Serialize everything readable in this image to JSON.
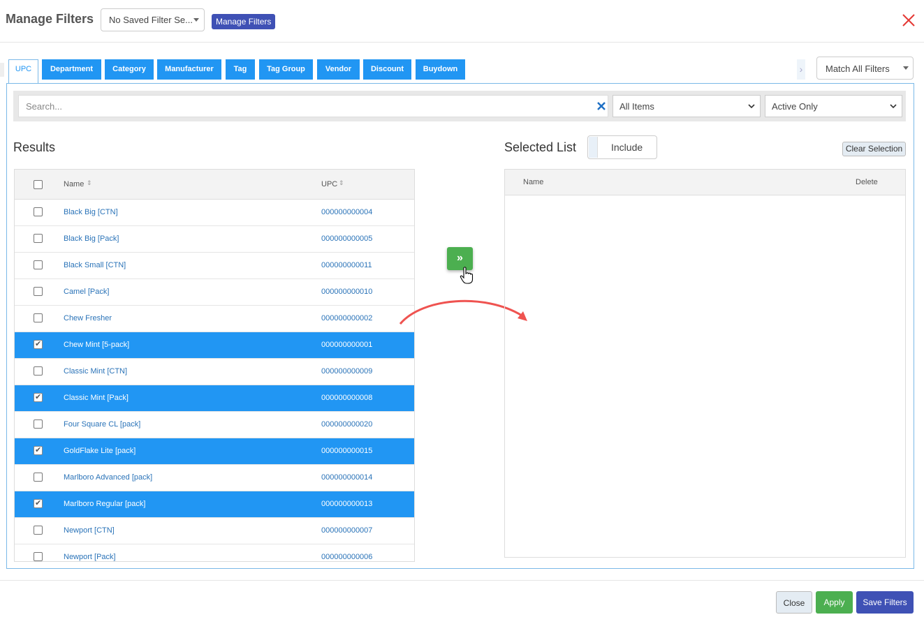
{
  "header": {
    "title": "Manage Filters",
    "saved_filter_select": "No Saved Filter Se...",
    "manage_filters_button": "Manage Filters"
  },
  "tabs": [
    {
      "label": "UPC",
      "active": true
    },
    {
      "label": "Department",
      "active": false
    },
    {
      "label": "Category",
      "active": false
    },
    {
      "label": "Manufacturer",
      "active": false
    },
    {
      "label": "Tag",
      "active": false
    },
    {
      "label": "Tag Group",
      "active": false
    },
    {
      "label": "Vendor",
      "active": false
    },
    {
      "label": "Discount",
      "active": false
    },
    {
      "label": "Buydown",
      "active": false
    }
  ],
  "match_select": "Match All Filters",
  "search": {
    "placeholder": "Search...",
    "items_filter": "All Items",
    "status_filter": "Active Only"
  },
  "results": {
    "title": "Results",
    "columns": [
      "Name",
      "UPC"
    ],
    "rows": [
      {
        "name": "Black Big [CTN]",
        "upc": "000000000004",
        "selected": false
      },
      {
        "name": "Black Big [Pack]",
        "upc": "000000000005",
        "selected": false
      },
      {
        "name": "Black Small [CTN]",
        "upc": "000000000011",
        "selected": false
      },
      {
        "name": "Camel [Pack]",
        "upc": "000000000010",
        "selected": false
      },
      {
        "name": "Chew Fresher",
        "upc": "000000000002",
        "selected": false
      },
      {
        "name": "Chew Mint [5-pack]",
        "upc": "000000000001",
        "selected": true
      },
      {
        "name": "Classic Mint [CTN]",
        "upc": "000000000009",
        "selected": false
      },
      {
        "name": "Classic Mint [Pack]",
        "upc": "000000000008",
        "selected": true
      },
      {
        "name": "Four Square CL [pack]",
        "upc": "000000000020",
        "selected": false
      },
      {
        "name": "GoldFlake Lite [pack]",
        "upc": "000000000015",
        "selected": true
      },
      {
        "name": "Marlboro Advanced [pack]",
        "upc": "000000000014",
        "selected": false
      },
      {
        "name": "Marlboro Regular [pack]",
        "upc": "000000000013",
        "selected": true
      },
      {
        "name": "Newport [CTN]",
        "upc": "000000000007",
        "selected": false
      },
      {
        "name": "Newport [Pack]",
        "upc": "000000000006",
        "selected": false
      }
    ]
  },
  "selected_list": {
    "title": "Selected List",
    "mode_toggle": "Include",
    "clear_button": "Clear Selection",
    "columns": [
      "Name",
      "Delete"
    ]
  },
  "footer": {
    "close": "Close",
    "apply": "Apply",
    "save": "Save Filters"
  },
  "colors": {
    "tab_blue": "#2196f3",
    "indigo": "#3f51b5",
    "green": "#4caf50",
    "close_red": "#e53935"
  }
}
